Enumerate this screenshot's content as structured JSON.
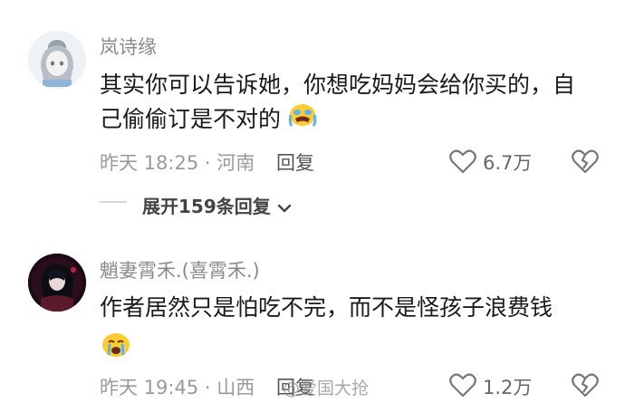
{
  "comments": [
    {
      "username": "岚诗缘",
      "content_line1": "其实你可以告诉她，你想吃妈妈会给你买的，自",
      "content_line2": "己偷偷订是不对的",
      "emoji": "crying-face",
      "time": "昨天 18:25",
      "location": "河南",
      "reply_label": "回复",
      "like_count": "6.7万",
      "expand_label": "展开159条回复"
    },
    {
      "username": "魈妻霄禾.(喜霄禾.)",
      "content_line1": "作者居然只是怕吃不完，而不是怪孩子浪费钱",
      "emoji": "crying-face",
      "time": "昨天 19:45",
      "location": "山西",
      "reply_label": "回复",
      "like_count": "1.2万"
    }
  ],
  "watermark": "@爱国大抢"
}
